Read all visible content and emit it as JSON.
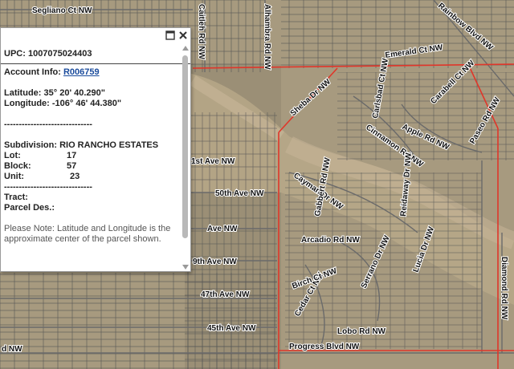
{
  "popup": {
    "upc_label": "UPC:",
    "upc_value": "1007075024403",
    "account_label": "Account Info:",
    "account_value": "R006759",
    "latitude_label": "Latitude:",
    "latitude_value": "35° 20' 40.290\"",
    "longitude_label": "Longitude:",
    "longitude_value": "-106° 46' 44.380\"",
    "separator": "------------------------------",
    "subdivision_label": "Subdivision:",
    "subdivision_value": "RIO RANCHO ESTATES",
    "lot_label": "Lot:",
    "lot_value": "17",
    "block_label": "Block:",
    "block_value": "57",
    "unit_label": "Unit:",
    "unit_value": "23",
    "tract_label": "Tract:",
    "parcel_label": "Parcel Des.:",
    "note": "Please Note: Latitude and Longitude is the approximate center of the parcel shown."
  },
  "map_labels": {
    "l1": "Segliano Ct NW",
    "l2": "Emerald Ct NW",
    "l3": "Rainbow Blvd NW",
    "l4": "Sheba Dr NW",
    "l5": "Caitleh Rd NW",
    "l6": "Alhambra Rd NW",
    "l7": "Carabell Ct NW",
    "l8": "Carlsbad Ct NW",
    "l9": "Apple Rd NW",
    "l10": "Paseo Rd NW",
    "l11": "Gabbert Rd NW",
    "l12": "Cayman Dr NW",
    "l13": "1st Ave NW",
    "l14": "50th Ave NW",
    "l15": "Ave NW",
    "l16": "9th Ave NW",
    "l17": "47th Ave NW",
    "l18": "45th Ave NW",
    "l19": "Arcadio Rd NW",
    "l20": "Reidaway Dr NW",
    "l21": "Cedar Ct NW",
    "l22": "Serrano Dr NW",
    "l23": "Lobo Rd NW",
    "l24": "Progress Blvd NW",
    "l25": "Diamond Rd NW",
    "l26": "d NW",
    "l27": "Lucia Dr NW",
    "l28": "Birch Ct NW",
    "l29": "Cinnamon Rd NW"
  },
  "icons": {
    "maximize": "maximize-icon",
    "close": "close-icon",
    "scroll_up": "scroll-up-icon",
    "scroll_down": "scroll-down-icon"
  },
  "colors": {
    "parcel_lines": "#4a4a4a",
    "boundary": "#e0362a",
    "terrain": "#a89a7e"
  }
}
